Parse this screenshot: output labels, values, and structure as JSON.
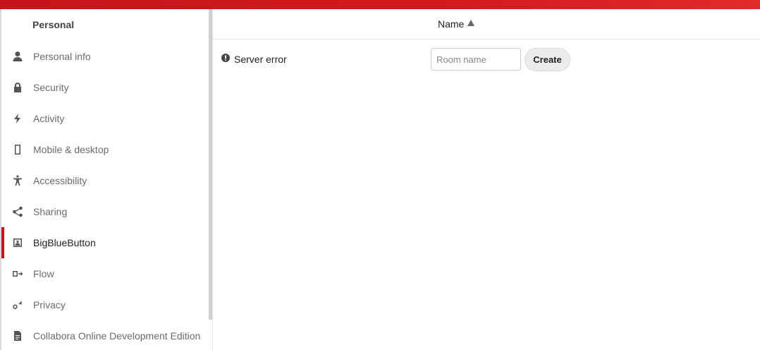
{
  "header": {
    "brand_color": "#c5141a"
  },
  "sidebar": {
    "section_title": "Personal",
    "items": [
      {
        "label": "Personal info",
        "icon": "user-icon",
        "active": false
      },
      {
        "label": "Security",
        "icon": "lock-icon",
        "active": false
      },
      {
        "label": "Activity",
        "icon": "lightning-icon",
        "active": false
      },
      {
        "label": "Mobile & desktop",
        "icon": "phone-icon",
        "active": false
      },
      {
        "label": "Accessibility",
        "icon": "accessibility-icon",
        "active": false
      },
      {
        "label": "Sharing",
        "icon": "share-icon",
        "active": false
      },
      {
        "label": "BigBlueButton",
        "icon": "bigbluebutton-icon",
        "active": true
      },
      {
        "label": "Flow",
        "icon": "flow-icon",
        "active": false
      },
      {
        "label": "Privacy",
        "icon": "key-icon",
        "active": false
      },
      {
        "label": "Collabora Online Development Edition",
        "icon": "document-icon",
        "active": false
      }
    ]
  },
  "main": {
    "column_header": "Name",
    "sort_icon": "sort-ascending-icon",
    "error_icon": "alert-icon",
    "error_text": "Server error",
    "room_input": {
      "placeholder": "Room name",
      "value": ""
    },
    "create_label": "Create"
  }
}
